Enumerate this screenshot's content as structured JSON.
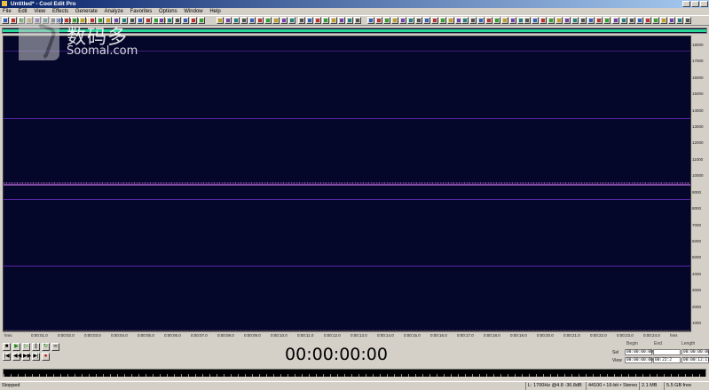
{
  "window": {
    "title": "Untitled* - Cool Edit Pro"
  },
  "menu": [
    "File",
    "Edit",
    "View",
    "Effects",
    "Generate",
    "Analyze",
    "Favorites",
    "Options",
    "Window",
    "Help"
  ],
  "watermark": {
    "cn": "数码多",
    "en": "Soomal.com"
  },
  "y_axis": {
    "ticks": [
      "18000",
      "17000",
      "16000",
      "15000",
      "14000",
      "13000",
      "12000",
      "11000",
      "10000",
      "9000",
      "8000",
      "7000",
      "6000",
      "5000",
      "4000",
      "3000",
      "2000",
      "1000"
    ]
  },
  "x_axis": {
    "ticks": [
      "hms",
      "0:00:01.0",
      "0:00:02.0",
      "0:00:03.0",
      "0:00:04.0",
      "0:00:05.0",
      "0:00:06.0",
      "0:00:07.0",
      "0:00:08.0",
      "0:00:09.0",
      "0:00:10.0",
      "0:00:11.0",
      "0:00:12.0",
      "0:00:13.0",
      "0:00:14.0",
      "0:00:15.0",
      "0:00:16.0",
      "0:00:17.0",
      "0:00:18.0",
      "0:00:19.0",
      "0:00:20.0",
      "0:00:21.0",
      "0:00:22.0",
      "0:00:23.0",
      "0:00:24.0",
      "hms"
    ]
  },
  "time_display": "00:00:00:00",
  "selection": {
    "headers": [
      "Begin",
      "End",
      "Length"
    ],
    "sel_label": "Sel",
    "view_label": "View",
    "sel_begin": "00:00:00:00",
    "sel_end": "",
    "sel_length": "00:00:00:00",
    "view_begin": "00:00:00:00",
    "view_end": "00:22:2",
    "view_length": "00:00:12:11"
  },
  "status": {
    "state": "Stopped",
    "format": "L: 1700Hz @4.8 -36.8dB",
    "sample": "44100 • 16-bit • Stereo",
    "size": "2.1 MB",
    "free": "5.5 GB free",
    "extra": "5.5 GB free"
  },
  "colors": {
    "waveform_bg": "#04062a",
    "overview_bar": "#2cd69a",
    "spectrum_line": "#7e4aa2"
  }
}
